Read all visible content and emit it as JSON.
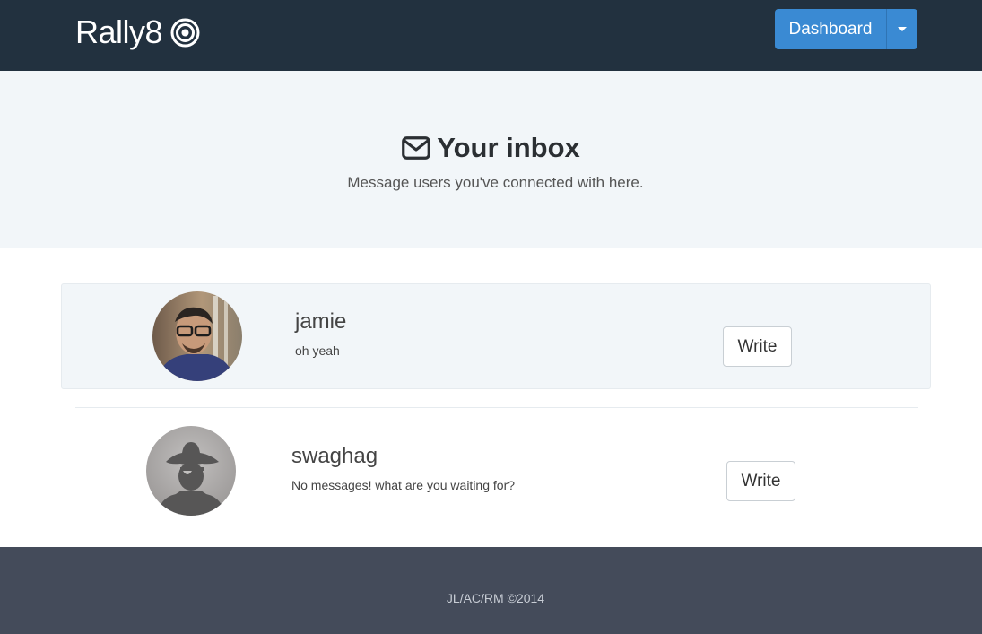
{
  "navbar": {
    "brand": "Rally8",
    "brand_icon": "target-icon",
    "dashboard_label": "Dashboard",
    "background": "#22313f",
    "accent": "#3a8ad3"
  },
  "hero": {
    "icon": "envelope-icon",
    "title": "Your inbox",
    "subtitle": "Message users you've connected with here."
  },
  "conversations": [
    {
      "username": "jamie",
      "last_message": "oh yeah",
      "action_label": "Write",
      "avatar": "photo-avatar"
    },
    {
      "username": "swaghag",
      "last_message": "No messages! what are you waiting for?",
      "action_label": "Write",
      "avatar": "pirate-silhouette-avatar"
    }
  ],
  "footer": {
    "text": "JL/AC/RM ©2014"
  }
}
